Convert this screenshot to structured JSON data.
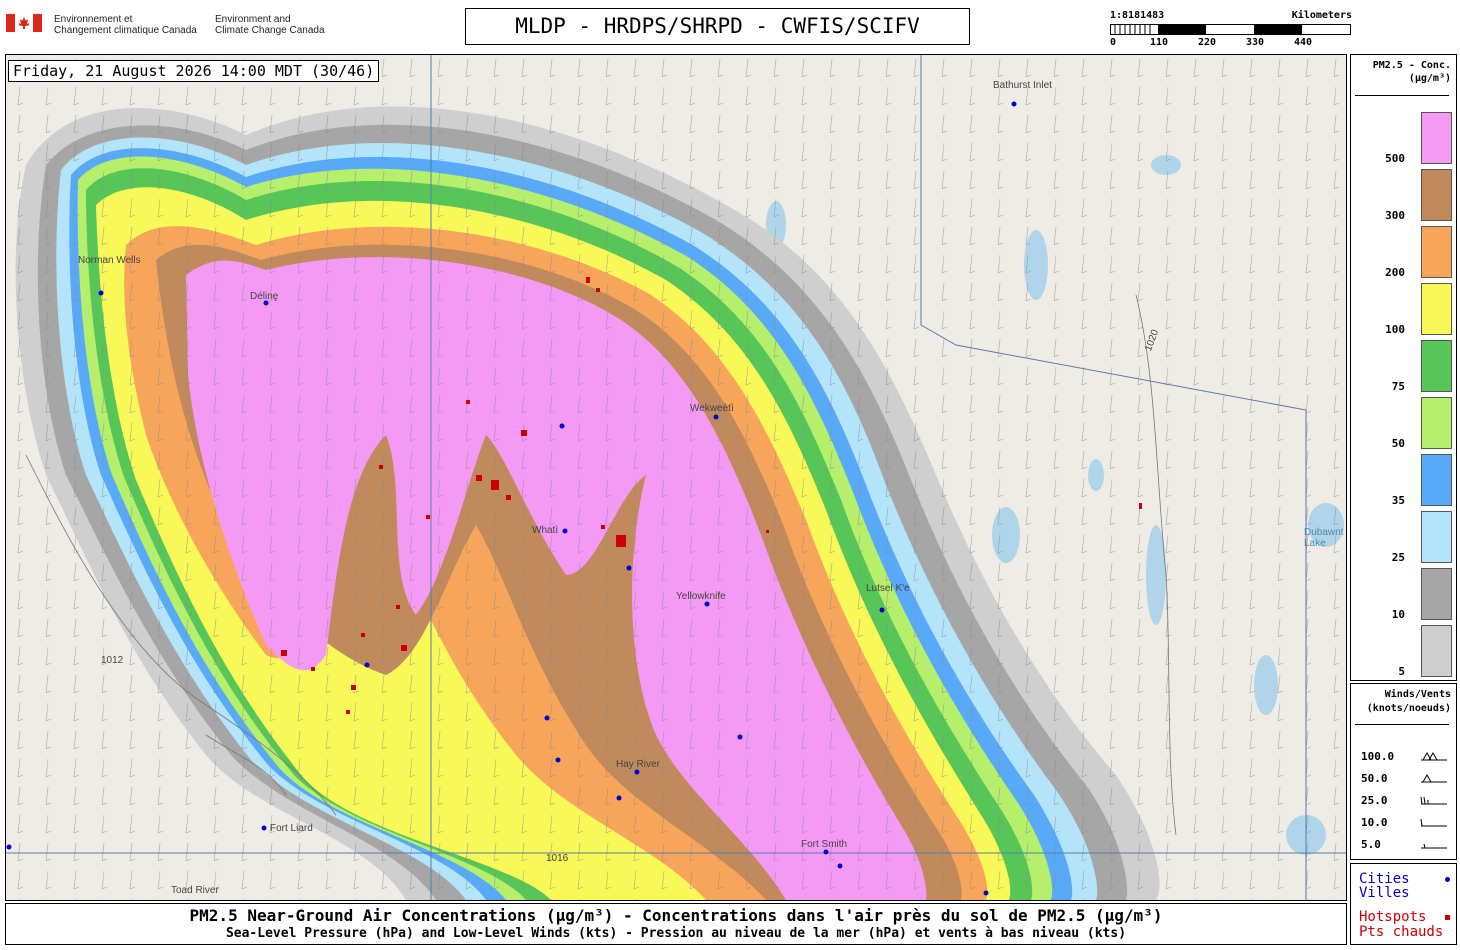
{
  "header": {
    "agency_fr_1": "Environnement et",
    "agency_fr_2": "Changement climatique Canada",
    "agency_en_1": "Environment and",
    "agency_en_2": "Climate Change Canada",
    "title": "MLDP - HRDPS/SHRPD - CWFIS/SCIFV"
  },
  "scale": {
    "ratio": "1:8181483",
    "unit": "Kilometers",
    "ticks": [
      "0",
      "110",
      "220",
      "330",
      "440"
    ]
  },
  "map": {
    "timestamp": "Friday, 21 August 2026 14:00 MDT (30/46)",
    "places": [
      "Bathurst Inlet",
      "Norman Wells",
      "Délinę",
      "Wekweètì",
      "Whatì",
      "Yellowknife",
      "Lutsel K'e",
      "Hay River",
      "Fort Liard",
      "Fort Smith",
      "Toad River",
      "Dubawnt Lake"
    ],
    "isobar_labels": [
      "1012",
      "1016",
      "1020"
    ]
  },
  "legend": {
    "title_1": "PM2.5 - Conc.",
    "title_2": "(µg/m³)",
    "levels": [
      {
        "value": "500",
        "color": "#f49af5"
      },
      {
        "value": "300",
        "color": "#c08a5c"
      },
      {
        "value": "200",
        "color": "#f7a55a"
      },
      {
        "value": "100",
        "color": "#f8f858"
      },
      {
        "value": "75",
        "color": "#58c558"
      },
      {
        "value": "50",
        "color": "#b5ef6c"
      },
      {
        "value": "35",
        "color": "#58aaf8"
      },
      {
        "value": "25",
        "color": "#b4e4fa"
      },
      {
        "value": "10",
        "color": "#a6a6a6"
      },
      {
        "value": "5",
        "color": "#cfcfcf"
      }
    ]
  },
  "winds": {
    "title_1": "Winds/Vents",
    "title_2": "(knots/noeuds)",
    "values": [
      "100.0",
      "50.0",
      "25.0",
      "10.0",
      "5.0"
    ]
  },
  "keys": {
    "cities_1": "Cities",
    "cities_2": "Villes",
    "hotspots_1": "Hotspots",
    "hotspots_2": "Pts chauds",
    "city_color": "#0000cc",
    "hotspot_color": "#cc0000"
  },
  "caption": {
    "line1": "PM2.5 Near-Ground Air Concentrations (µg/m³) - Concentrations dans l'air près du sol de PM2.5 (µg/m³)",
    "line2": "Sea-Level Pressure (hPa) and Low-Level Winds (kts) - Pression au niveau de la mer (hPa) et vents à bas niveau (kts)"
  }
}
